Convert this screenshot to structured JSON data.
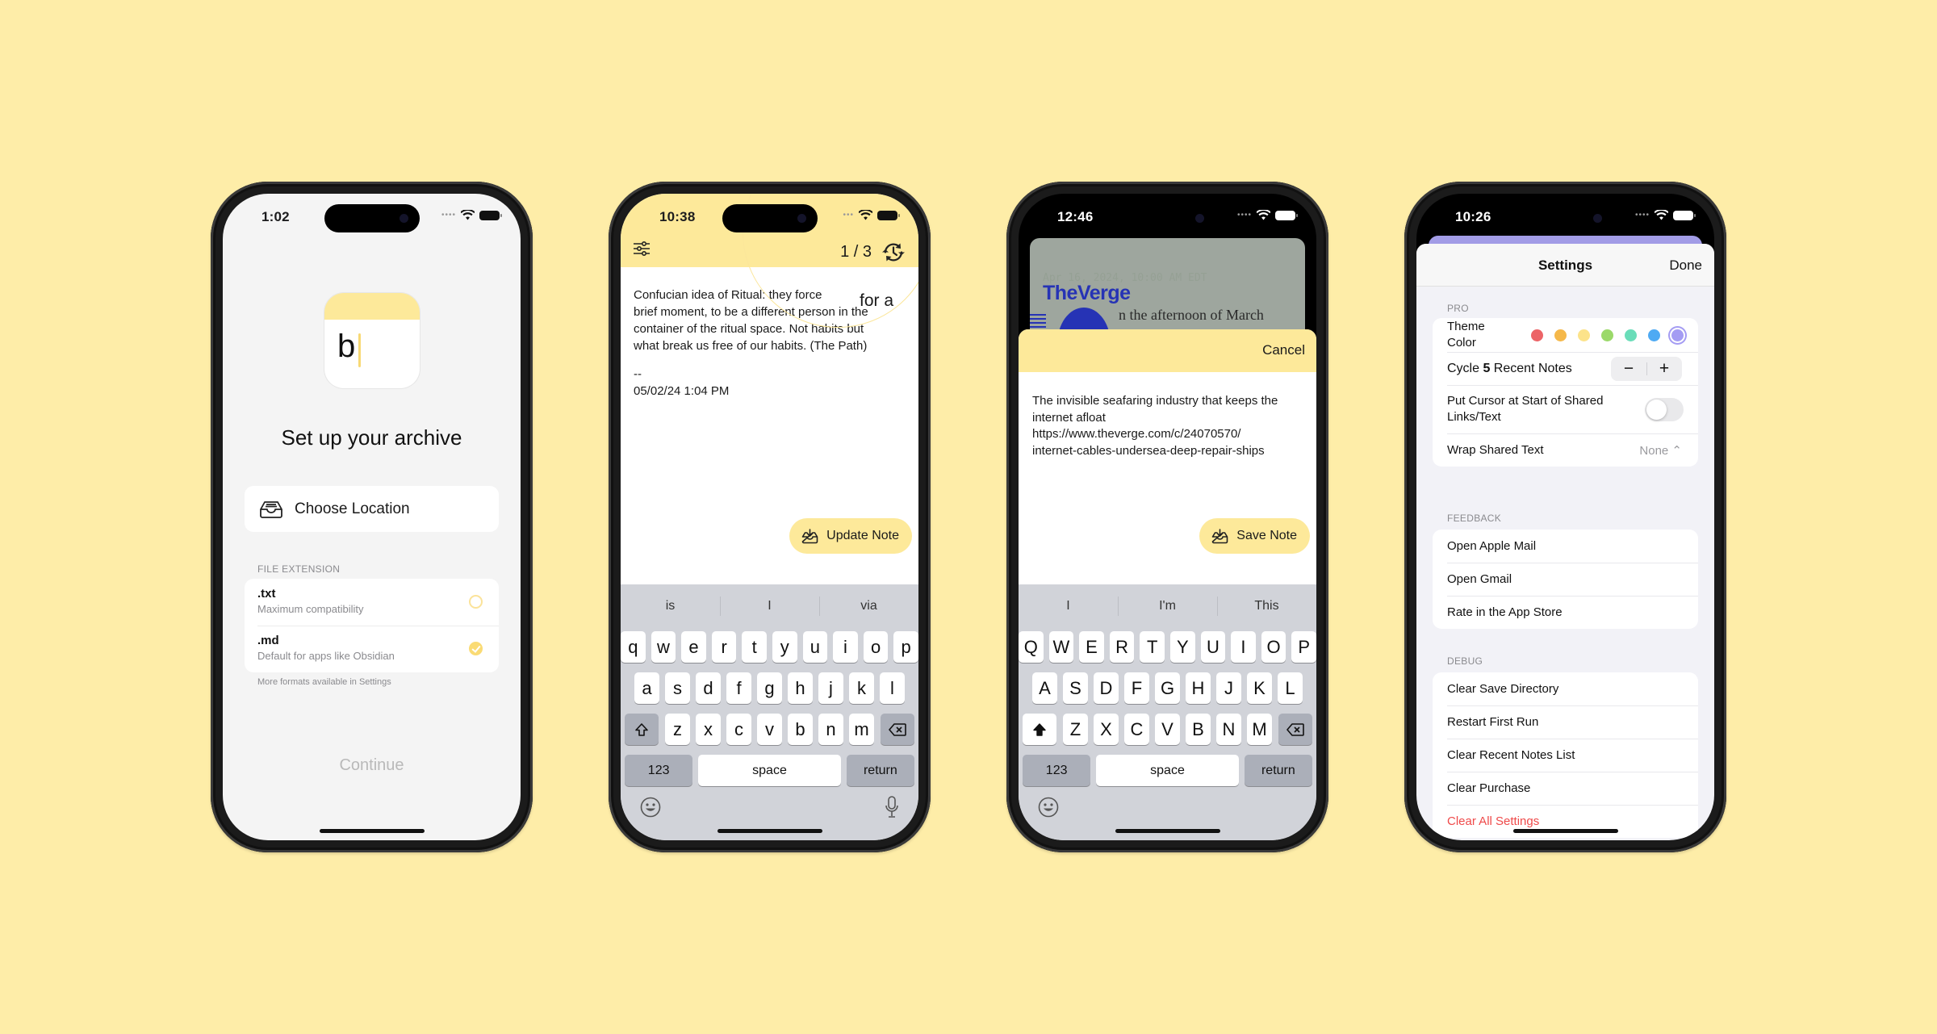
{
  "colors": {
    "background": "#FEEDA8",
    "accent_yellow": "#FDE99A",
    "destructive": "#EF4A4A",
    "keyboard": "#D1D3D9"
  },
  "phones": {
    "onboarding": {
      "status": {
        "time": "1:02"
      },
      "app_icon_letter": "b",
      "title": "Set up your archive",
      "choose_location": {
        "label": "Choose Location",
        "icon": "tray-icon"
      },
      "file_extension": {
        "section_label": "FILE EXTENSION",
        "options": [
          {
            "name": ".txt",
            "description": "Maximum compatibility",
            "selected": false
          },
          {
            "name": ".md",
            "description": "Default for apps like Obsidian",
            "selected": true
          }
        ],
        "footnote": "More formats available in Settings"
      },
      "continue_label": "Continue"
    },
    "editor": {
      "status": {
        "time": "10:38"
      },
      "toolbar": {
        "filter_icon": "sliders-icon",
        "counter": "1 / 3",
        "history_icon": "clock-rotate-icon"
      },
      "magnified_text": "for a",
      "note_text": "Confucian idea of Ritual: they force\nbrief moment, to be a different person in the\ncontainer of the ritual space. Not habits but\nwhat break us free of our habits. (The Path)",
      "signature": "--\n05/02/24 1:04 PM",
      "action_button": "Update Note",
      "keyboard": {
        "suggestions": [
          "is",
          "I",
          "via"
        ],
        "row1": [
          "q",
          "w",
          "e",
          "r",
          "t",
          "y",
          "u",
          "i",
          "o",
          "p"
        ],
        "row2": [
          "a",
          "s",
          "d",
          "f",
          "g",
          "h",
          "j",
          "k",
          "l"
        ],
        "row3": [
          "z",
          "x",
          "c",
          "v",
          "b",
          "n",
          "m"
        ],
        "numbers": "123",
        "space": "space",
        "return": "return"
      }
    },
    "share_sheet": {
      "status": {
        "time": "12:46"
      },
      "background_page": {
        "date": "Apr 16, 2024, 10:00 AM EDT",
        "logo": "TheVerge",
        "snippet": "n the afternoon of March"
      },
      "cancel_label": "Cancel",
      "body_lines": [
        "The invisible seafaring industry that keeps the",
        "internet afloat",
        "https://www.theverge.com/c/24070570/",
        "internet-cables-undersea-deep-repair-ships"
      ],
      "action_button": "Save Note",
      "keyboard": {
        "suggestions": [
          "I",
          "I'm",
          "This"
        ],
        "row1": [
          "Q",
          "W",
          "E",
          "R",
          "T",
          "Y",
          "U",
          "I",
          "O",
          "P"
        ],
        "row2": [
          "A",
          "S",
          "D",
          "F",
          "G",
          "H",
          "J",
          "K",
          "L"
        ],
        "row3": [
          "Z",
          "X",
          "C",
          "V",
          "B",
          "N",
          "M"
        ],
        "numbers": "123",
        "space": "space",
        "return": "return"
      }
    },
    "settings": {
      "status": {
        "time": "10:26"
      },
      "title": "Settings",
      "done_label": "Done",
      "pro": {
        "section_label": "PRO",
        "theme_color_label": "Theme\nColor",
        "theme_colors": [
          "#EC6467",
          "#F5B84A",
          "#FCE38A",
          "#9BD96A",
          "#6ADDB9",
          "#4EAAF3",
          "#A49CF3"
        ],
        "selected_theme_index": 6,
        "cycle_label_prefix": "Cycle ",
        "cycle_count": "5",
        "cycle_label_suffix": " Recent Notes",
        "stepper_minus": "−",
        "stepper_plus": "+",
        "cursor_label": "Put Cursor at Start of Shared Links/Text",
        "cursor_toggle_on": false,
        "wrap_label": "Wrap Shared Text",
        "wrap_value": "None ⌃"
      },
      "feedback": {
        "section_label": "FEEDBACK",
        "items": [
          "Open Apple Mail",
          "Open Gmail",
          "Rate in the App Store"
        ]
      },
      "debug": {
        "section_label": "DEBUG",
        "items": [
          "Clear Save Directory",
          "Restart First Run",
          "Clear Recent Notes List",
          "Clear Purchase"
        ],
        "destructive_item": "Clear All Settings"
      }
    }
  }
}
